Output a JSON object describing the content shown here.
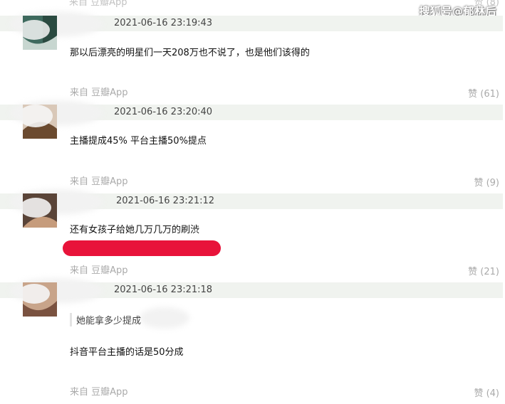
{
  "watermark": "搜狐号@郁林后",
  "top_partial": {
    "source": "来自 豆瓣App",
    "like": "赞 (8)"
  },
  "comments": [
    {
      "timestamp": "2021-06-16 23:19:43",
      "text": "那以后漂亮的明星们一天208万也不说了，也是他们该得的",
      "source": "来自 豆瓣App",
      "like": "赞 (61)"
    },
    {
      "timestamp": "2021-06-16 23:20:40",
      "text": "主播提成45% 平台主播50%提点",
      "source": "来自 豆瓣App",
      "like": "赞 (9)"
    },
    {
      "timestamp": "2021-06-16 23:21:12",
      "text": "还有女孩子给她几万几万的刷渋",
      "source": "来自 豆瓣App",
      "like": "赞 (21)"
    },
    {
      "timestamp": "2021-06-16 23:21:18",
      "quote": "她能拿多少提成",
      "text": "抖音平台主播的话是50分成",
      "source": "来自 豆瓣App",
      "like": "赞 (4)"
    }
  ]
}
